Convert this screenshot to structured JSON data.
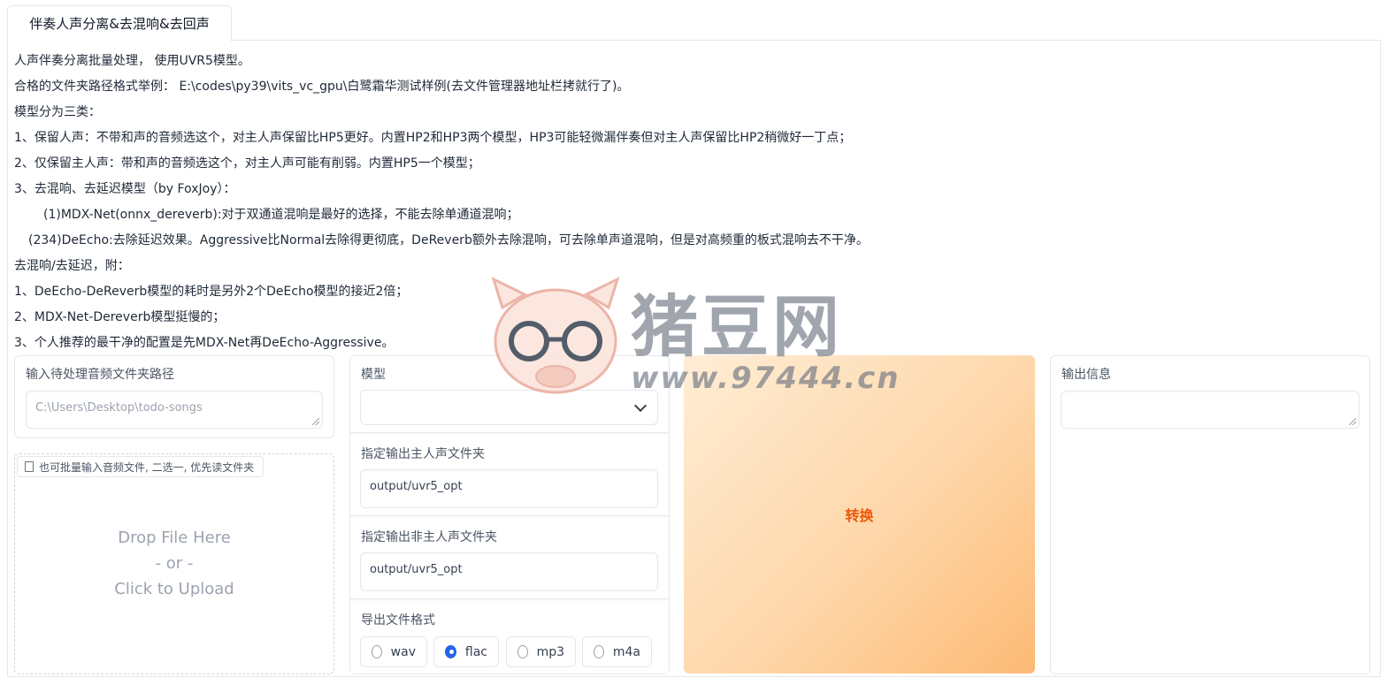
{
  "tabs": [
    {
      "label": "伴奏人声分离&去混响&去回声"
    }
  ],
  "description": [
    "人声伴奏分离批量处理， 使用UVR5模型。",
    "合格的文件夹路径格式举例： E:\\codes\\py39\\vits_vc_gpu\\白鹭霜华测试样例(去文件管理器地址栏拷就行了)。",
    "模型分为三类：",
    "1、保留人声：不带和声的音频选这个，对主人声保留比HP5更好。内置HP2和HP3两个模型，HP3可能轻微漏伴奏但对主人声保留比HP2稍微好一丁点；",
    "2、仅保留主人声：带和声的音频选这个，对主人声可能有削弱。内置HP5一个模型；",
    "3、去混响、去延迟模型（by FoxJoy）：",
    "        (1)MDX-Net(onnx_dereverb):对于双通道混响是最好的选择，不能去除单通道混响；",
    "    (234)DeEcho:去除延迟效果。Aggressive比Normal去除得更彻底，DeReverb额外去除混响，可去除单声道混响，但是对高频重的板式混响去不干净。",
    "去混响/去延迟，附：",
    "1、DeEcho-DeReverb模型的耗时是另外2个DeEcho模型的接近2倍；",
    "2、MDX-Net-Dereverb模型挺慢的；",
    "3、个人推荐的最干净的配置是先MDX-Net再DeEcho-Aggressive。"
  ],
  "input_dir": {
    "label": "输入待处理音频文件夹路径",
    "placeholder": "C:\\Users\\Desktop\\todo-songs"
  },
  "upload": {
    "label": "也可批量输入音频文件, 二选一, 优先读文件夹",
    "drop_line1": "Drop File Here",
    "drop_line2": "- or -",
    "drop_line3": "Click to Upload"
  },
  "model": {
    "label": "模型",
    "value": ""
  },
  "vocal_out": {
    "label": "指定输出主人声文件夹",
    "value": "output/uvr5_opt"
  },
  "ins_out": {
    "label": "指定输出非主人声文件夹",
    "value": "output/uvr5_opt"
  },
  "format": {
    "label": "导出文件格式",
    "options": [
      "wav",
      "flac",
      "mp3",
      "m4a"
    ],
    "selected": "flac"
  },
  "convert": {
    "label": "转换"
  },
  "output": {
    "label": "输出信息",
    "value": ""
  },
  "watermark": {
    "brand": "猪豆网",
    "url": "www.97444.cn"
  },
  "colors": {
    "accent": "#2563eb",
    "button_text": "#ea580c",
    "button_bg": "#fdba74"
  }
}
